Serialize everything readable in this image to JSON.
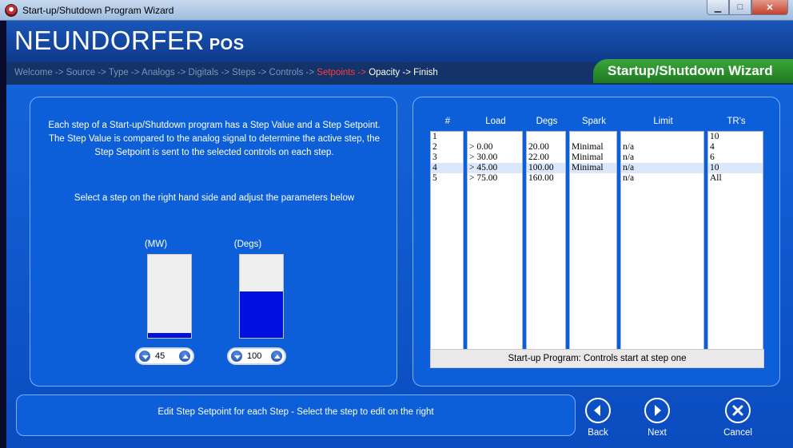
{
  "window": {
    "title": "Start-up/Shutdown Program Wizard"
  },
  "brand": {
    "name": "NEUNDORFER",
    "suffix": "POS"
  },
  "breadcrumb": {
    "before": "Welcome -> Source -> Type -> Analogs -> Digitals -> Steps -> Controls ->",
    "current": " Setpoints -> ",
    "after": "Opacity -> Finish"
  },
  "wizard_tab": "Startup/Shutdown Wizard",
  "left_panel": {
    "description": "Each step of a Start-up/Shutdown program has a Step Value and a Step Setpoint. The Step Value is compared to the analog signal to determine the active step, the Step Setpoint is sent to the selected controls on each step.",
    "instruction": "Select a step on the right hand side and adjust the parameters below",
    "gauges": [
      {
        "label": "(MW)",
        "value": "45",
        "level": 0.03
      },
      {
        "label": "(Degs)",
        "value": "100",
        "level": 0.56
      }
    ]
  },
  "steps_table": {
    "columns": [
      "#",
      "Load",
      "Degs",
      "Spark",
      "Limit",
      "TR's"
    ],
    "rows": [
      [
        "1",
        "",
        "",
        "",
        "",
        "10"
      ],
      [
        "2",
        "> 0.00",
        "20.00",
        "Minimal",
        "n/a",
        "4"
      ],
      [
        "3",
        "> 30.00",
        "22.00",
        "Minimal",
        "n/a",
        "6"
      ],
      [
        "4",
        "> 45.00",
        "100.00",
        "Minimal",
        "n/a",
        "10"
      ],
      [
        "5",
        "> 75.00",
        "160.00",
        "",
        "n/a",
        "All"
      ]
    ],
    "selected_row": 4,
    "status": "Start-up Program: Controls start at step one"
  },
  "message": "Edit Step Setpoint for each Step - Select the step to edit on the right",
  "nav": {
    "back": "Back",
    "next": "Next",
    "cancel": "Cancel"
  }
}
